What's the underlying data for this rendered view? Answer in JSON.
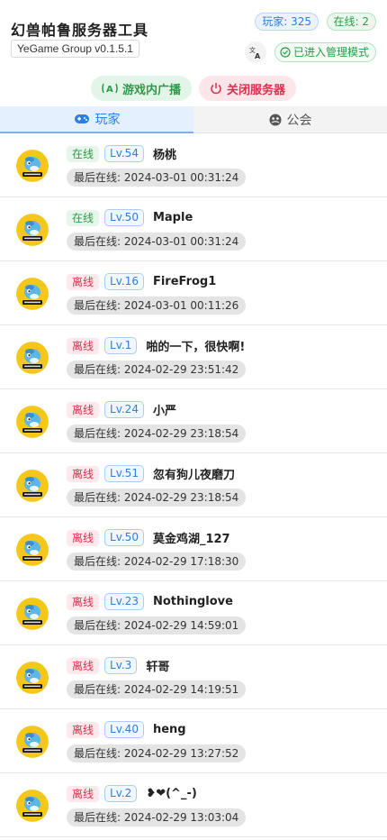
{
  "app": {
    "title": "幻兽帕鲁服务器工具",
    "version": "YeGame Group v0.1.5.1",
    "players_badge": "玩家: 325",
    "online_badge": "在线: 2",
    "admin_mode": "已进入管理模式"
  },
  "actions": {
    "broadcast": "游戏内广播",
    "shutdown": "关闭服务器"
  },
  "tabs": [
    {
      "label": "玩家",
      "icon": "gamepad-icon",
      "active": true
    },
    {
      "label": "公会",
      "icon": "guild-icon",
      "active": false
    }
  ],
  "players": [
    {
      "status": "在线",
      "online": true,
      "level": "Lv.54",
      "name": "杨桃",
      "last_seen": "最后在线: 2024-03-01 00:31:24"
    },
    {
      "status": "在线",
      "online": true,
      "level": "Lv.50",
      "name": "Maple",
      "last_seen": "最后在线: 2024-03-01 00:31:24"
    },
    {
      "status": "离线",
      "online": false,
      "level": "Lv.16",
      "name": "FireFrog1",
      "last_seen": "最后在线: 2024-03-01 00:11:26"
    },
    {
      "status": "离线",
      "online": false,
      "level": "Lv.1",
      "name": "啪的一下，很快啊!",
      "last_seen": "最后在线: 2024-02-29 23:51:42"
    },
    {
      "status": "离线",
      "online": false,
      "level": "Lv.24",
      "name": "小严",
      "last_seen": "最后在线: 2024-02-29 23:18:54"
    },
    {
      "status": "离线",
      "online": false,
      "level": "Lv.51",
      "name": "忽有狗儿夜磨刀",
      "last_seen": "最后在线: 2024-02-29 23:18:54"
    },
    {
      "status": "离线",
      "online": false,
      "level": "Lv.50",
      "name": "莫金鸡湖_127",
      "last_seen": "最后在线: 2024-02-29 17:18:30"
    },
    {
      "status": "离线",
      "online": false,
      "level": "Lv.23",
      "name": "Nothinglove",
      "last_seen": "最后在线: 2024-02-29 14:59:01"
    },
    {
      "status": "离线",
      "online": false,
      "level": "Lv.3",
      "name": "轩哥",
      "last_seen": "最后在线: 2024-02-29 14:19:51"
    },
    {
      "status": "离线",
      "online": false,
      "level": "Lv.40",
      "name": "heng",
      "last_seen": "最后在线: 2024-02-29 13:27:52"
    },
    {
      "status": "离线",
      "online": false,
      "level": "Lv.2",
      "name": "❥❤︎(^_-)",
      "last_seen": "最后在线: 2024-02-29 13:03:04"
    }
  ],
  "colors": {
    "online": "#2e9a48",
    "offline": "#d8304d",
    "accent": "#2f7de1"
  }
}
